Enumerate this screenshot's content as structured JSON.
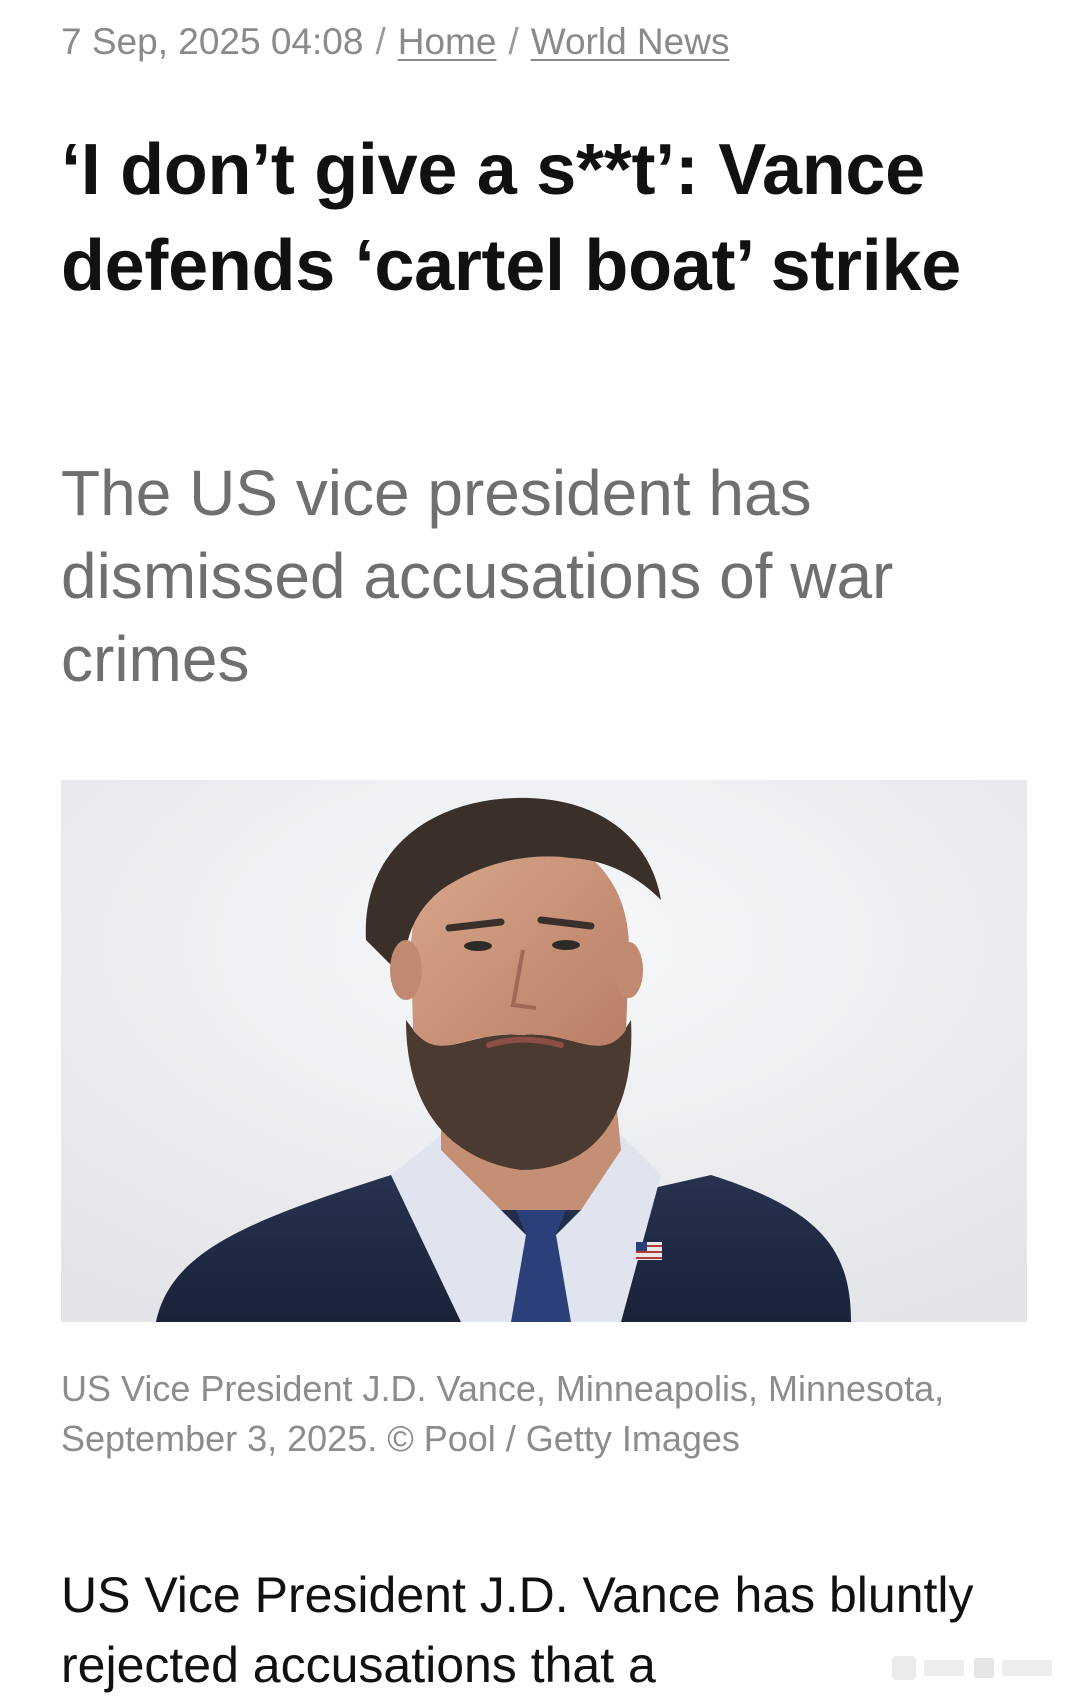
{
  "breadcrumb": {
    "date": "7 Sep, 2025 04:08",
    "separator": "/",
    "items": [
      {
        "label": "Home"
      },
      {
        "label": "World News"
      }
    ]
  },
  "article": {
    "headline": "‘I don’t give a s**t’: Vance defends ‘cartel boat’ strike",
    "subheadline": "The US vice president has dismissed accusations of war crimes",
    "image": {
      "subject": "portrait photo of J.D. Vance in a navy suit and blue tie against a pale sky"
    },
    "caption": "US Vice President J.D. Vance, Minneapolis, Minnesota, September 3, 2025. ©  Pool / Getty Images",
    "body_start": "US Vice President J.D. Vance has bluntly rejected accusations that a"
  },
  "colors": {
    "meta_gray": "#8a8a8a",
    "subhead_gray": "#6f6f6f",
    "text": "#111111",
    "suit_navy": "#1f2a44"
  }
}
